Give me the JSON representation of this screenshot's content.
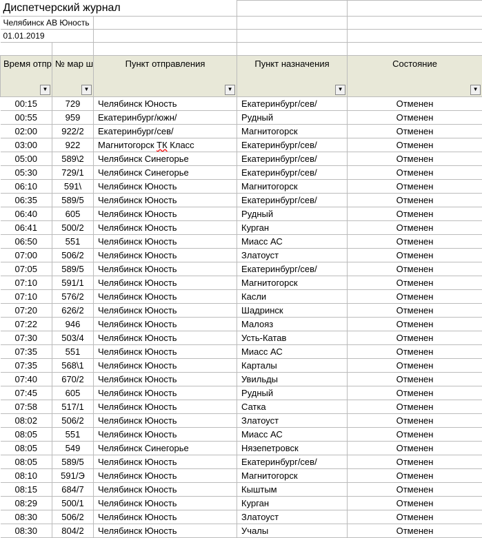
{
  "title": "Диспетчерский журнал",
  "station": "Челябинск АВ Юность",
  "date": "01.01.2019",
  "columns": {
    "time": "Время отпр.",
    "route": "№ мар шр.",
    "departure": "Пункт отправления",
    "destination": "Пункт назначения",
    "status": "Состояние"
  },
  "rows": [
    {
      "time": "00:15",
      "route": "729",
      "dep": "Челябинск Юность",
      "dest": "Екатеринбург/сев/",
      "status": "Отменен"
    },
    {
      "time": "00:55",
      "route": "959",
      "dep": "Екатеринбург/южн/",
      "dest": "Рудный",
      "status": "Отменен"
    },
    {
      "time": "02:00",
      "route": "922/2",
      "dep": "Екатеринбург/сев/",
      "dest": "Магнитогорск",
      "status": "Отменен"
    },
    {
      "time": "03:00",
      "route": "922",
      "dep": "Магнитогорск ТК Класс",
      "dest": "Екатеринбург/сев/",
      "status": "Отменен"
    },
    {
      "time": "05:00",
      "route": "589\\2",
      "dep": "Челябинск Синегорье",
      "dest": "Екатеринбург/сев/",
      "status": "Отменен"
    },
    {
      "time": "05:30",
      "route": "729/1",
      "dep": "Челябинск Синегорье",
      "dest": "Екатеринбург/сев/",
      "status": "Отменен"
    },
    {
      "time": "06:10",
      "route": "591\\",
      "dep": "Челябинск Юность",
      "dest": "Магнитогорск",
      "status": "Отменен"
    },
    {
      "time": "06:35",
      "route": "589/5",
      "dep": "Челябинск Юность",
      "dest": "Екатеринбург/сев/",
      "status": "Отменен"
    },
    {
      "time": "06:40",
      "route": "605",
      "dep": "Челябинск Юность",
      "dest": "Рудный",
      "status": "Отменен"
    },
    {
      "time": "06:41",
      "route": "500/2",
      "dep": "Челябинск Юность",
      "dest": "Курган",
      "status": "Отменен"
    },
    {
      "time": "06:50",
      "route": "551",
      "dep": "Челябинск Юность",
      "dest": "Миасс АС",
      "status": "Отменен"
    },
    {
      "time": "07:00",
      "route": "506/2",
      "dep": "Челябинск Юность",
      "dest": "Златоуст",
      "status": "Отменен"
    },
    {
      "time": "07:05",
      "route": "589/5",
      "dep": "Челябинск Юность",
      "dest": "Екатеринбург/сев/",
      "status": "Отменен"
    },
    {
      "time": "07:10",
      "route": "591/1",
      "dep": "Челябинск Юность",
      "dest": "Магнитогорск",
      "status": "Отменен"
    },
    {
      "time": "07:10",
      "route": "576/2",
      "dep": "Челябинск Юность",
      "dest": "Касли",
      "status": "Отменен"
    },
    {
      "time": "07:20",
      "route": "626/2",
      "dep": "Челябинск Юность",
      "dest": "Шадринск",
      "status": "Отменен"
    },
    {
      "time": "07:22",
      "route": "946",
      "dep": "Челябинск Юность",
      "dest": "Малояз",
      "status": "Отменен"
    },
    {
      "time": "07:30",
      "route": "503/4",
      "dep": "Челябинск Юность",
      "dest": "Усть-Катав",
      "status": "Отменен"
    },
    {
      "time": "07:35",
      "route": "551",
      "dep": "Челябинск Юность",
      "dest": "Миасс АС",
      "status": "Отменен"
    },
    {
      "time": "07:35",
      "route": "568\\1",
      "dep": "Челябинск Юность",
      "dest": "Карталы",
      "status": "Отменен"
    },
    {
      "time": "07:40",
      "route": "670/2",
      "dep": "Челябинск Юность",
      "dest": "Увильды",
      "status": "Отменен"
    },
    {
      "time": "07:45",
      "route": "605",
      "dep": "Челябинск Юность",
      "dest": "Рудный",
      "status": "Отменен"
    },
    {
      "time": "07:58",
      "route": "517/1",
      "dep": "Челябинск Юность",
      "dest": "Сатка",
      "status": "Отменен"
    },
    {
      "time": "08:02",
      "route": "506/2",
      "dep": "Челябинск Юность",
      "dest": "Златоуст",
      "status": "Отменен"
    },
    {
      "time": "08:05",
      "route": "551",
      "dep": "Челябинск Юность",
      "dest": "Миасс АС",
      "status": "Отменен"
    },
    {
      "time": "08:05",
      "route": "549",
      "dep": "Челябинск Синегорье",
      "dest": "Нязепетровск",
      "status": "Отменен"
    },
    {
      "time": "08:05",
      "route": "589/5",
      "dep": "Челябинск Юность",
      "dest": "Екатеринбург/сев/",
      "status": "Отменен"
    },
    {
      "time": "08:10",
      "route": "591/Э",
      "dep": "Челябинск Юность",
      "dest": "Магнитогорск",
      "status": "Отменен"
    },
    {
      "time": "08:15",
      "route": "684/7",
      "dep": "Челябинск Юность",
      "dest": "Кыштым",
      "status": "Отменен"
    },
    {
      "time": "08:29",
      "route": "500/1",
      "dep": "Челябинск Юность",
      "dest": "Курган",
      "status": "Отменен"
    },
    {
      "time": "08:30",
      "route": "506/2",
      "dep": "Челябинск Юность",
      "dest": "Златоуст",
      "status": "Отменен"
    },
    {
      "time": "08:30",
      "route": "804/2",
      "dep": "Челябинск Юность",
      "dest": "Учалы",
      "status": "Отменен"
    }
  ]
}
